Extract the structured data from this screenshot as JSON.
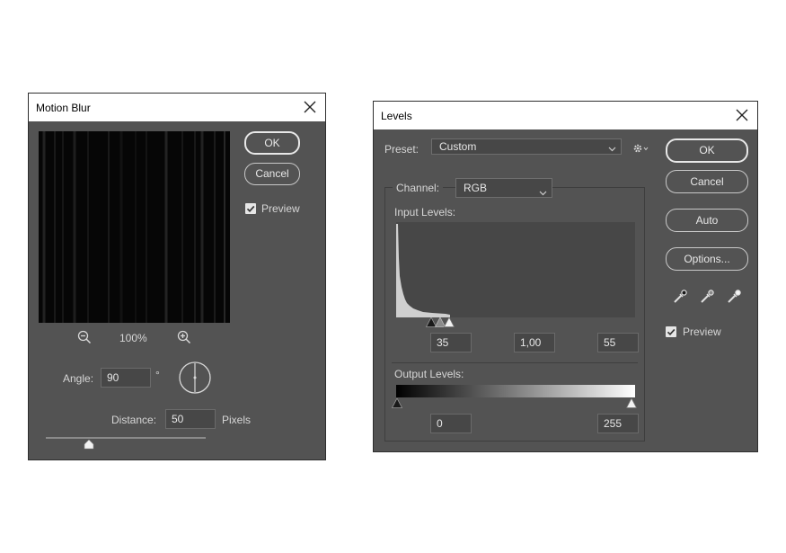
{
  "motion_blur": {
    "title": "Motion Blur",
    "ok_label": "OK",
    "cancel_label": "Cancel",
    "preview_label": "Preview",
    "preview_checked": true,
    "zoom_level": "100%",
    "angle_label": "Angle:",
    "angle_value": "90",
    "degree_symbol": "°",
    "distance_label": "Distance:",
    "distance_value": "50",
    "distance_unit": "Pixels",
    "distance_slider_fraction": 0.27
  },
  "levels": {
    "title": "Levels",
    "preset_label": "Preset:",
    "preset_value": "Custom",
    "channel_label": "Channel:",
    "channel_value": "RGB",
    "input_levels_label": "Input Levels:",
    "input_black": "35",
    "input_gamma": "1,00",
    "input_white": "55",
    "output_levels_label": "Output Levels:",
    "output_black": "0",
    "output_white": "255",
    "ok_label": "OK",
    "cancel_label": "Cancel",
    "auto_label": "Auto",
    "options_label": "Options...",
    "preview_label": "Preview",
    "preview_checked": true
  }
}
